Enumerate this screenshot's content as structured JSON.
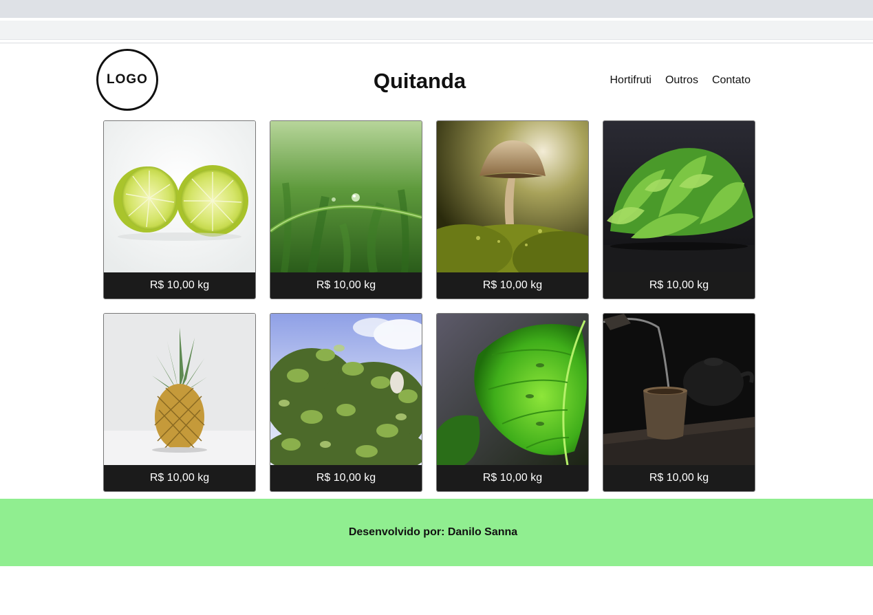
{
  "header": {
    "logo_text": "LOGO",
    "title": "Quitanda",
    "nav": [
      "Hortifruti",
      "Outros",
      "Contato"
    ]
  },
  "products": [
    {
      "image": "lime-halves",
      "price": "R$ 10,00 kg"
    },
    {
      "image": "grass-dewdrop",
      "price": "R$ 10,00 kg"
    },
    {
      "image": "mushroom",
      "price": "R$ 10,00 kg"
    },
    {
      "image": "lettuce",
      "price": "R$ 10,00 kg"
    },
    {
      "image": "pineapple",
      "price": "R$ 10,00 kg"
    },
    {
      "image": "tree-leaves",
      "price": "R$ 10,00 kg"
    },
    {
      "image": "monstera-leaf",
      "price": "R$ 10,00 kg"
    },
    {
      "image": "tea-cup",
      "price": "R$ 10,00 kg"
    }
  ],
  "footer": {
    "text": "Desenvolvido por: Danilo Sanna"
  },
  "colors": {
    "footer_bg": "#90ee90",
    "price_bar": "#1b1b1b"
  }
}
